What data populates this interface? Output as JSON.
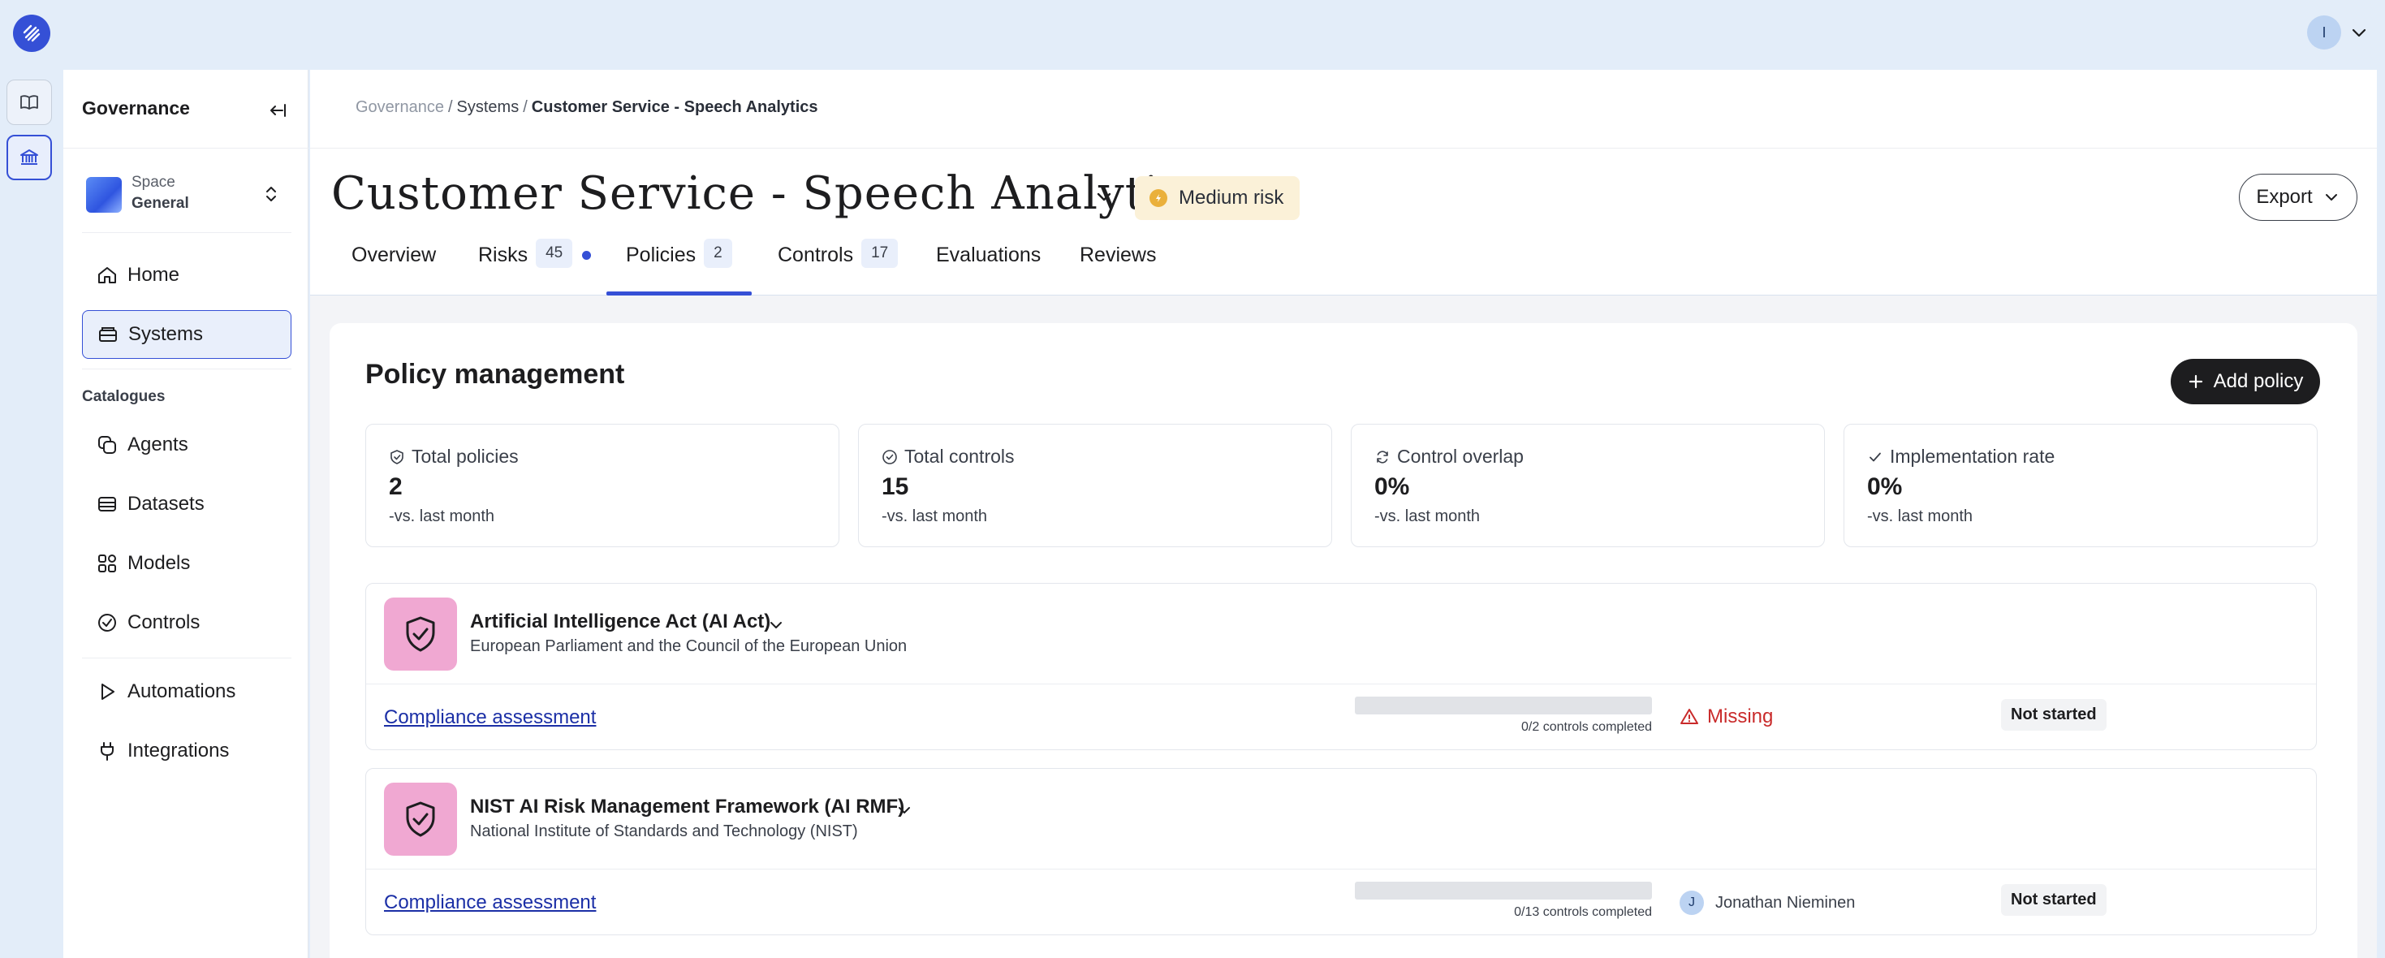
{
  "user": {
    "initial": "I"
  },
  "sidebar": {
    "title": "Governance",
    "space": {
      "label": "Space",
      "name": "General"
    },
    "primary": [
      {
        "label": "Home",
        "icon": "home-icon"
      },
      {
        "label": "Systems",
        "icon": "systems-icon",
        "active": true
      }
    ],
    "section_label": "Catalogues",
    "catalogues": [
      {
        "label": "Agents",
        "icon": "agents-icon"
      },
      {
        "label": "Datasets",
        "icon": "datasets-icon"
      },
      {
        "label": "Models",
        "icon": "models-icon"
      },
      {
        "label": "Controls",
        "icon": "controls-icon"
      }
    ],
    "tools": [
      {
        "label": "Automations",
        "icon": "play-icon"
      },
      {
        "label": "Integrations",
        "icon": "plug-icon"
      }
    ]
  },
  "breadcrumb": {
    "root": "Governance",
    "parent": "Systems",
    "current": "Customer Service - Speech Analytics",
    "separator": "/"
  },
  "header": {
    "title": "Customer Service - Speech Analytics",
    "risk_label": "Medium risk",
    "risk_color": "#eab03b",
    "export_label": "Export"
  },
  "tabs": [
    {
      "label": "Overview",
      "count": null
    },
    {
      "label": "Risks",
      "count": "45",
      "dot": true
    },
    {
      "label": "Policies",
      "count": "2",
      "active": true
    },
    {
      "label": "Controls",
      "count": "17"
    },
    {
      "label": "Evaluations",
      "count": null
    },
    {
      "label": "Reviews",
      "count": null
    }
  ],
  "policy_management": {
    "title": "Policy management",
    "add_label": "Add policy",
    "stats": [
      {
        "label": "Total policies",
        "icon": "shield-check-icon",
        "value": "2",
        "sub": "-vs. last month"
      },
      {
        "label": "Total controls",
        "icon": "check-circle-icon",
        "value": "15",
        "sub": "-vs. last month"
      },
      {
        "label": "Control overlap",
        "icon": "refresh-icon",
        "value": "0%",
        "sub": "-vs. last month"
      },
      {
        "label": "Implementation rate",
        "icon": "check-icon",
        "value": "0%",
        "sub": "-vs. last month"
      }
    ],
    "policies": [
      {
        "name": "Artificial Intelligence Act (AI Act)",
        "org": "European Parliament and the Council of the European Union",
        "link": "Compliance assessment",
        "progress": 0,
        "progress_text": "0/2 controls completed",
        "status": "Missing",
        "status_color": "#c92a2a",
        "state": "Not started"
      },
      {
        "name": "NIST AI Risk Management Framework (AI RMF)",
        "org": "National Institute of Standards and Technology (NIST)",
        "link": "Compliance assessment",
        "progress": 0,
        "progress_text": "0/13 controls completed",
        "owner_initial": "J",
        "owner": "Jonathan Nieminen",
        "state": "Not started"
      }
    ]
  },
  "colors": {
    "accent": "#3550d6",
    "policy_icon_bg": "#f0a8d2"
  }
}
